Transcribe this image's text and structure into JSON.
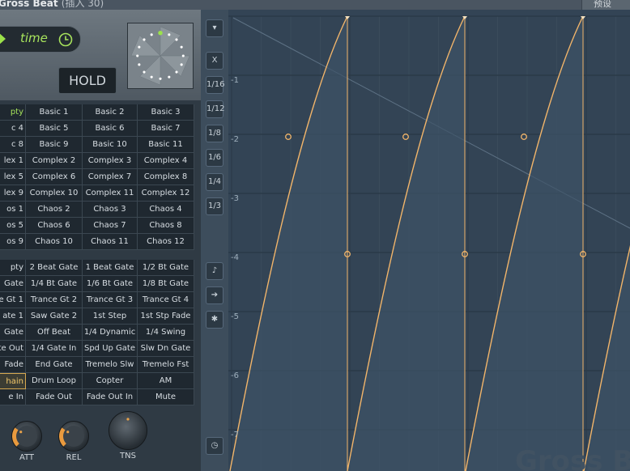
{
  "window": {
    "title": "Gross Beat",
    "subtitle": "(插入 30)",
    "preset_label": "预设"
  },
  "mode": {
    "label": "time",
    "hold_label": "HOLD"
  },
  "time_presets": [
    [
      "pty",
      "Basic 1",
      "Basic 2",
      "Basic 3"
    ],
    [
      "c 4",
      "Basic 5",
      "Basic 6",
      "Basic 7"
    ],
    [
      "c 8",
      "Basic 9",
      "Basic 10",
      "Basic 11"
    ],
    [
      "lex 1",
      "Complex 2",
      "Complex 3",
      "Complex 4"
    ],
    [
      "lex 5",
      "Complex 6",
      "Complex 7",
      "Complex 8"
    ],
    [
      "lex 9",
      "Complex 10",
      "Complex 11",
      "Complex 12"
    ],
    [
      "os 1",
      "Chaos 2",
      "Chaos 3",
      "Chaos 4"
    ],
    [
      "os 5",
      "Chaos 6",
      "Chaos 7",
      "Chaos 8"
    ],
    [
      "os 9",
      "Chaos 10",
      "Chaos 11",
      "Chaos 12"
    ]
  ],
  "volume_presets": [
    [
      "pty",
      "2 Beat Gate",
      "1 Beat Gate",
      "1/2 Bt Gate"
    ],
    [
      "Gate",
      "1/4 Bt Gate",
      "1/6 Bt Gate",
      "1/8 Bt Gate"
    ],
    [
      "e Gt 1",
      "Trance Gt 2",
      "Trance Gt 3",
      "Trance Gt 4"
    ],
    [
      "ate 1",
      "Saw Gate 2",
      "1st Step",
      "1st Stp Fade"
    ],
    [
      "Gate",
      "Off Beat",
      "1/4 Dynamic",
      "1/4 Swing"
    ],
    [
      "te Out",
      "1/4 Gate In",
      "Spd Up Gate",
      "Slw Dn Gate"
    ],
    [
      "Fade",
      "End Gate",
      "Tremelo Slw",
      "Tremelo Fst"
    ],
    [
      "hain",
      "Drum Loop",
      "Copter",
      "AM"
    ],
    [
      "e In",
      "Fade Out",
      "Fade Out In",
      "Mute"
    ]
  ],
  "knobs": [
    {
      "label": "ATT",
      "value": 0.3
    },
    {
      "label": "REL",
      "value": 0.3
    },
    {
      "label": "TNS",
      "value": 0.5
    }
  ],
  "side_buttons": [
    "▾",
    "X",
    "1/16",
    "1/12",
    "1/8",
    "1/6",
    "1/4",
    "1/3"
  ],
  "y_labels": [
    "-1",
    "-2",
    "-3",
    "-4",
    "-5",
    "-6",
    "-7"
  ],
  "watermark": "Gross Beat",
  "colors": {
    "accent_green": "#a4e05a",
    "envelope": "#f2b56a",
    "selected": "#f3c86a"
  }
}
